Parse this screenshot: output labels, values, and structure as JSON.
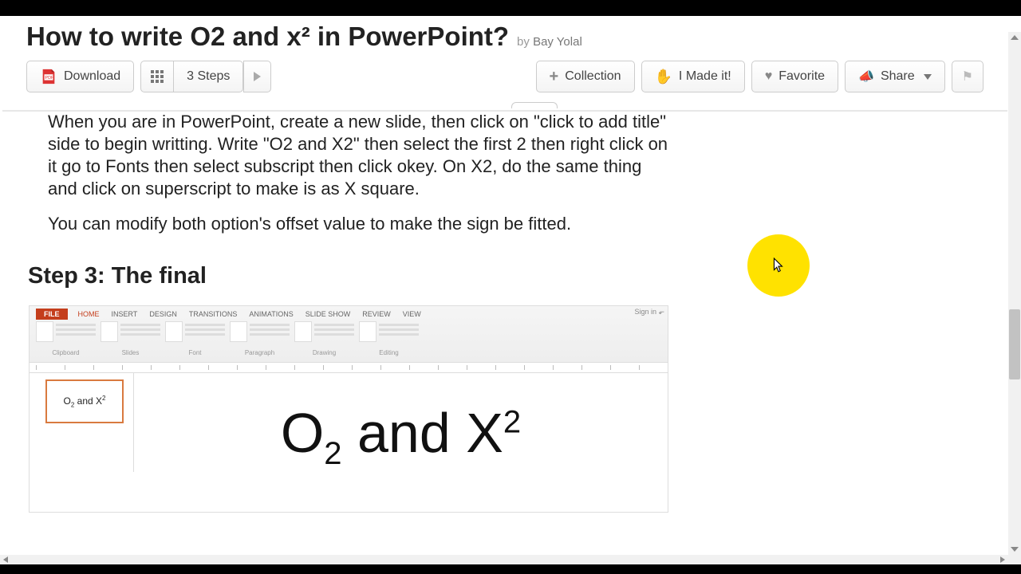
{
  "header": {
    "title": "How to write O2 and x² in PowerPoint?",
    "byPrefix": "by ",
    "author": "Bay Yolal"
  },
  "toolbar": {
    "download": "Download",
    "steps": "3 Steps",
    "collection": "Collection",
    "made_it": "I Made it!",
    "favorite": "Favorite",
    "share": "Share"
  },
  "body": {
    "p1": "When you are in PowerPoint, create a new slide, then click on \"click to add title\" side to begin writting. Write \"O2 and X2\" then select the first 2 then right click on it go to Fonts then select subscript then click okey. On X2, do the same thing and click on superscript to make is as X square.",
    "p2": "You can modify both option's offset value to make the sign be fitted."
  },
  "step": {
    "heading": "Step 3: The final"
  },
  "ppt": {
    "tabs": [
      "FILE",
      "HOME",
      "INSERT",
      "DESIGN",
      "TRANSITIONS",
      "ANIMATIONS",
      "SLIDE SHOW",
      "REVIEW",
      "VIEW"
    ],
    "signin": "Sign in",
    "ribbonGroups": [
      "Clipboard",
      "Slides",
      "Font",
      "Paragraph",
      "Drawing",
      "Editing"
    ],
    "thumb": "O₂ and X²",
    "slideText": "O₂ and X²"
  }
}
